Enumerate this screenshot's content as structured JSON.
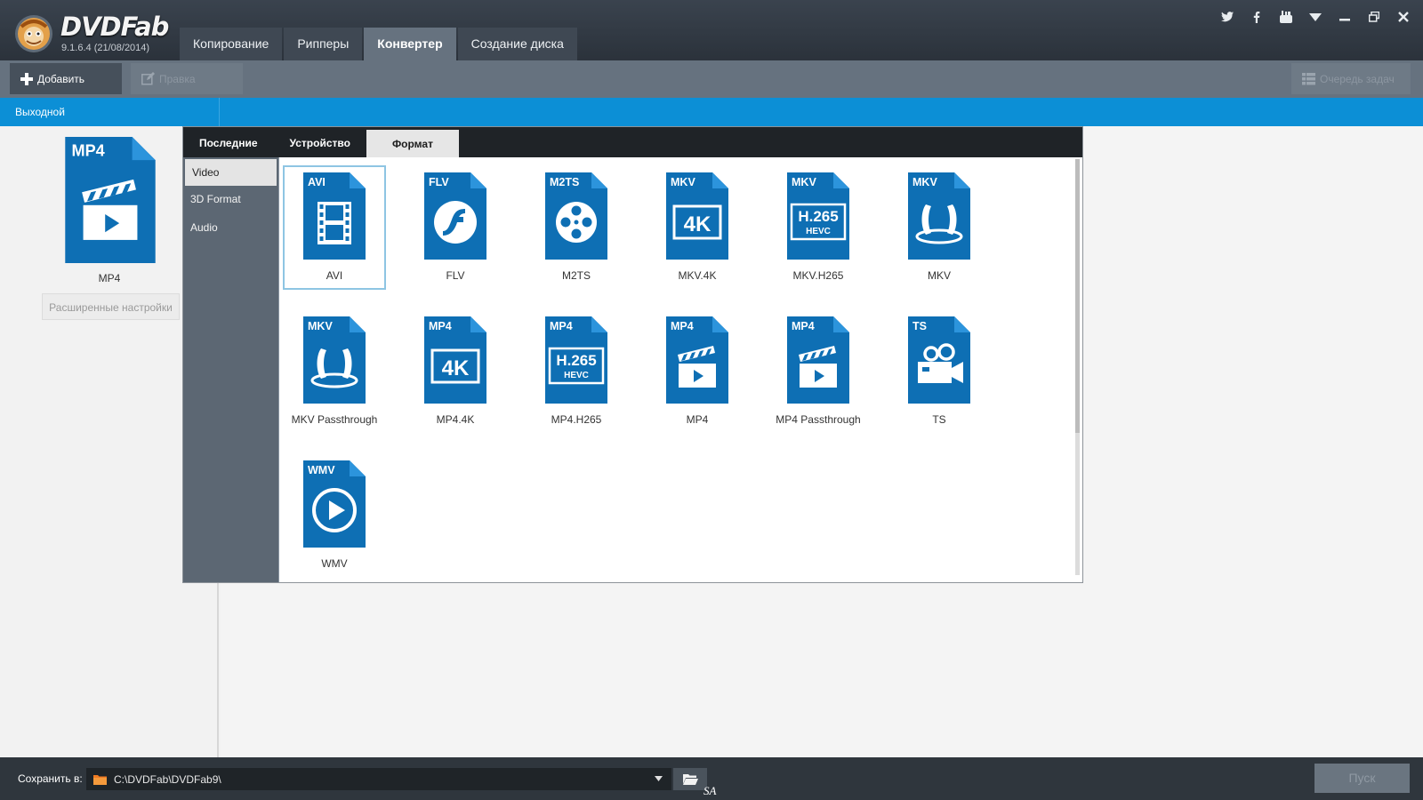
{
  "app": {
    "brand": "DVDFab",
    "version": "9.1.6.4 (21/08/2014)"
  },
  "main_tabs": [
    {
      "label": "Копирование",
      "active": false
    },
    {
      "label": "Рипперы",
      "active": false
    },
    {
      "label": "Конвертер",
      "active": true
    },
    {
      "label": "Создание диска",
      "active": false
    }
  ],
  "window_icons": [
    "twitter-icon",
    "facebook-icon",
    "youtube-icon",
    "menu-dropdown-icon",
    "minimize-icon",
    "restore-icon",
    "close-icon"
  ],
  "toolbar": {
    "add_label": "Добавить",
    "edit_label": "Правка",
    "queue_label": "Очередь задач"
  },
  "output_header": "Выходной",
  "profile": {
    "badge": "MP4",
    "name": "MP4",
    "advanced_label": "Расширенные настройки"
  },
  "popup": {
    "tabs": [
      {
        "label": "Последние",
        "active": false
      },
      {
        "label": "Устройство",
        "active": false
      },
      {
        "label": "Формат",
        "active": true
      }
    ],
    "side_items": [
      {
        "label": "Video",
        "active": true
      },
      {
        "label": "3D Format",
        "active": false
      },
      {
        "label": "Audio",
        "active": false
      }
    ],
    "formats": [
      {
        "badge": "AVI",
        "label": "AVI",
        "icon": "film",
        "selected": true
      },
      {
        "badge": "FLV",
        "label": "FLV",
        "icon": "flash",
        "selected": false
      },
      {
        "badge": "M2TS",
        "label": "M2TS",
        "icon": "reel",
        "selected": false
      },
      {
        "badge": "MKV",
        "label": "MKV.4K",
        "icon": "4k",
        "selected": false
      },
      {
        "badge": "MKV",
        "label": "MKV.H265",
        "icon": "h265",
        "selected": false
      },
      {
        "badge": "MKV",
        "label": "MKV",
        "icon": "mkv",
        "selected": false
      },
      {
        "badge": "MKV",
        "label": "MKV Passthrough",
        "icon": "mkv",
        "selected": false
      },
      {
        "badge": "MP4",
        "label": "MP4.4K",
        "icon": "4k",
        "selected": false
      },
      {
        "badge": "MP4",
        "label": "MP4.H265",
        "icon": "h265",
        "selected": false
      },
      {
        "badge": "MP4",
        "label": "MP4",
        "icon": "clapper",
        "selected": false
      },
      {
        "badge": "MP4",
        "label": "MP4 Passthrough",
        "icon": "clapper",
        "selected": false
      },
      {
        "badge": "TS",
        "label": "TS",
        "icon": "camera",
        "selected": false
      },
      {
        "badge": "WMV",
        "label": "WMV",
        "icon": "play",
        "selected": false
      }
    ],
    "h265_text": "H.265",
    "hevc_text": "HEVC",
    "k4_text": "4K"
  },
  "bottom": {
    "save_label": "Сохранить в:",
    "path": "C:\\DVDFab\\DVDFab9\\",
    "signature": "SA",
    "start_label": "Пуск"
  },
  "colors": {
    "icon_blue": "#0e6fb4",
    "icon_fold": "#2c94dc",
    "accent": "#0c8fd6",
    "dark": "#2b323b"
  }
}
